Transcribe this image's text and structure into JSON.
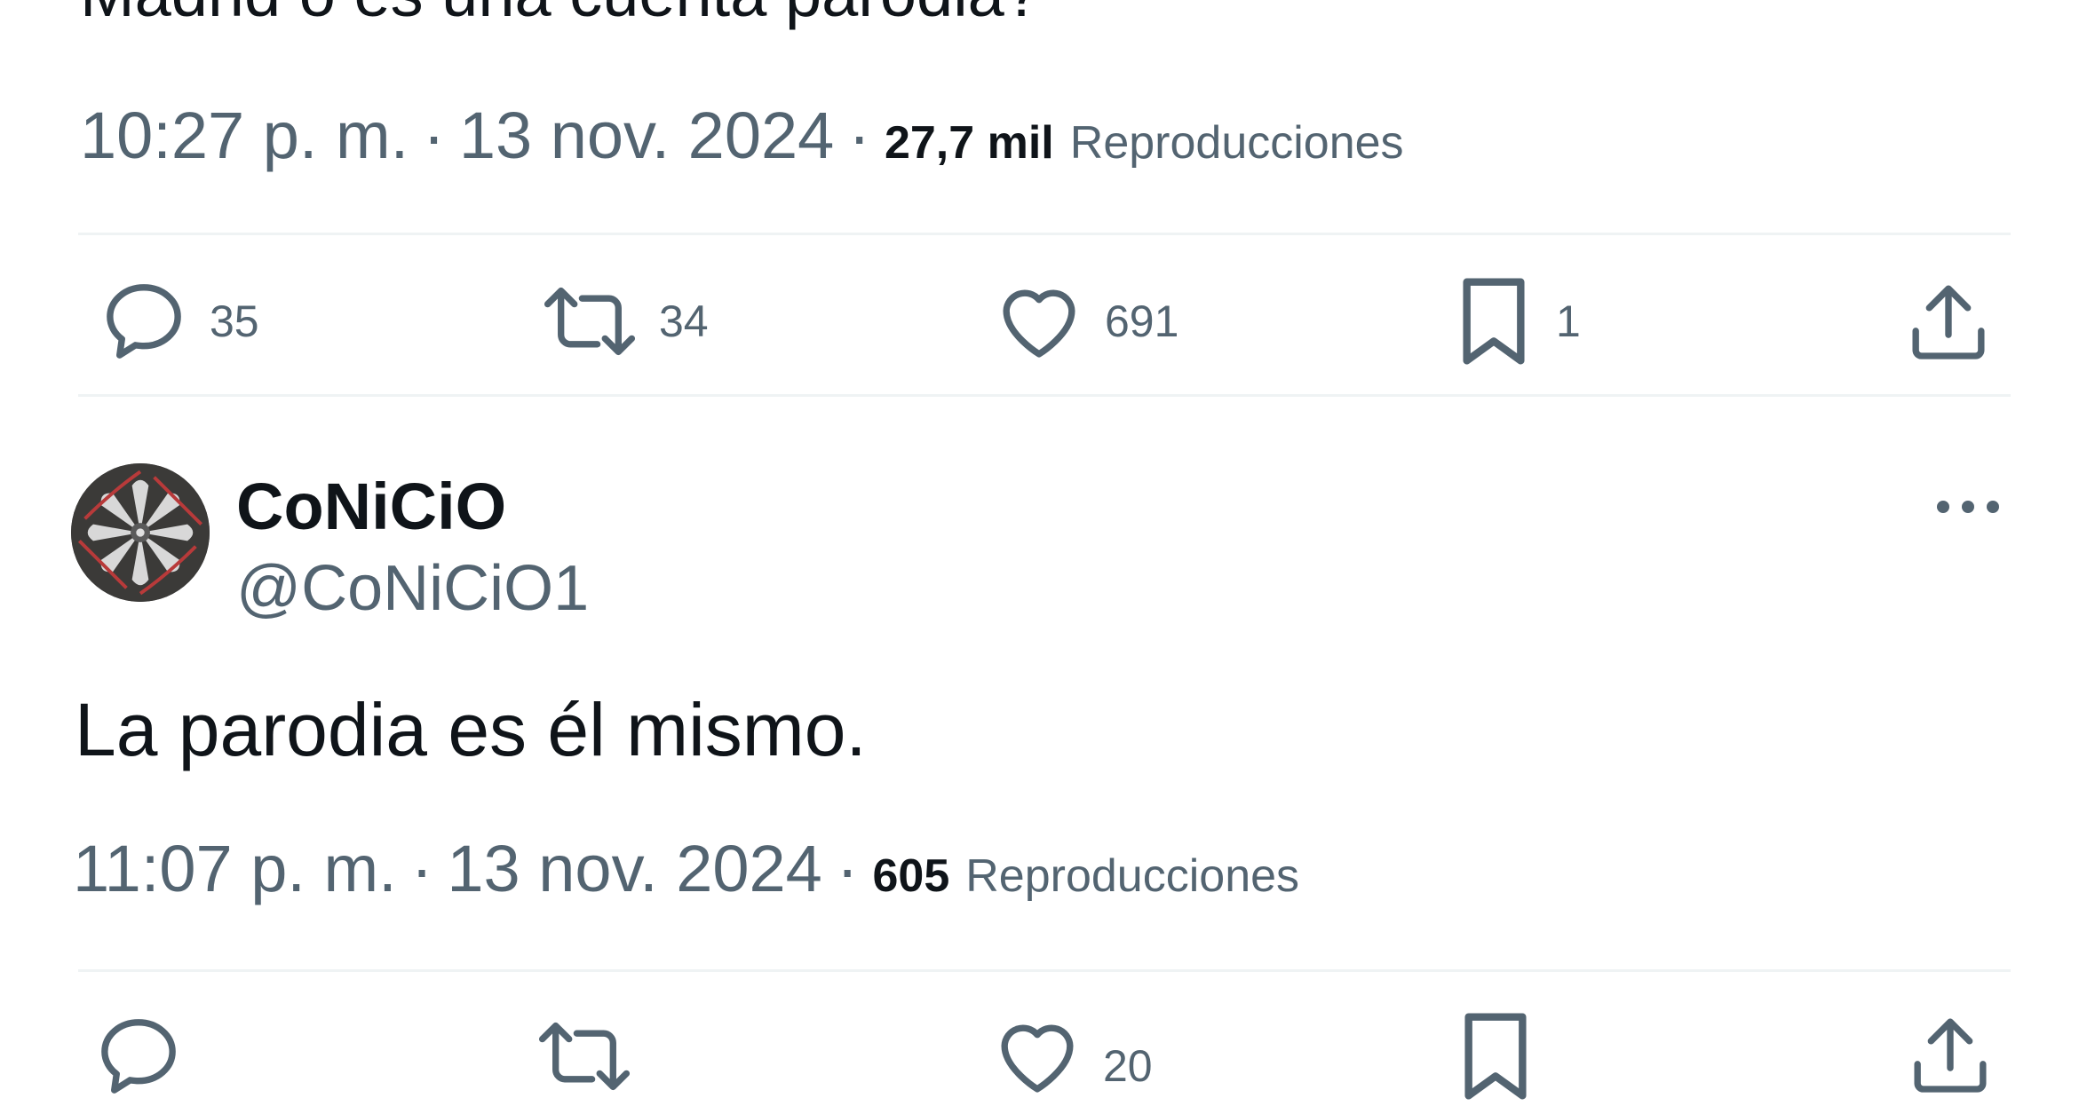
{
  "first_tweet": {
    "text_partial": "Madrid o es una cuenta parodia?",
    "time": "10:27 p. m.",
    "separator": "·",
    "date": "13 nov. 2024",
    "views_count": "27,7 mil",
    "views_label": "Reproducciones",
    "actions": {
      "reply_count": "35",
      "retweet_count": "34",
      "like_count": "691",
      "bookmark_count": "1"
    }
  },
  "reply_tweet": {
    "display_name": "CoNiCiO",
    "handle": "@CoNiCiO1",
    "text": "La parodia es él mismo.",
    "time": "11:07 p. m.",
    "separator": "·",
    "date": "13 nov. 2024",
    "views_count": "605",
    "views_label": "Reproducciones",
    "actions": {
      "like_count": "20"
    }
  },
  "icons": {
    "reply": "comment-bubble-icon",
    "retweet": "retweet-icon",
    "like": "heart-icon",
    "bookmark": "bookmark-icon",
    "share": "share-upload-icon",
    "more": "more-dots-icon"
  },
  "colors": {
    "text_primary": "#0f1419",
    "text_secondary": "#536471",
    "divider": "#eff3f4",
    "background": "#ffffff"
  }
}
